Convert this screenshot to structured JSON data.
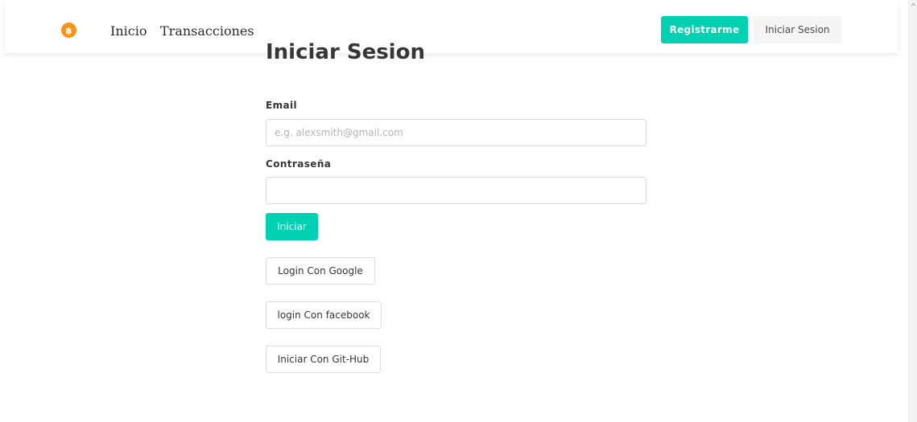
{
  "navbar": {
    "brand_icon": "bitcoin-icon",
    "links": [
      "Inicio",
      "Transacciones"
    ],
    "register_label": "Registrarme",
    "login_label": "Iniciar Sesion"
  },
  "form": {
    "title": "Iniciar Sesion",
    "email_label": "Email",
    "email_placeholder": "e.g. alexsmith@gmail.com",
    "email_value": "",
    "password_label": "Contraseña",
    "password_value": "",
    "submit_label": "Iniciar"
  },
  "social": {
    "google_label": "Login Con Google",
    "facebook_label": "login Con facebook",
    "github_label": "Iniciar Con Git-Hub"
  },
  "colors": {
    "primary": "#00d1b2",
    "brand": "#f7931a",
    "light_button": "#f5f5f5",
    "border": "#dbdbdb"
  }
}
